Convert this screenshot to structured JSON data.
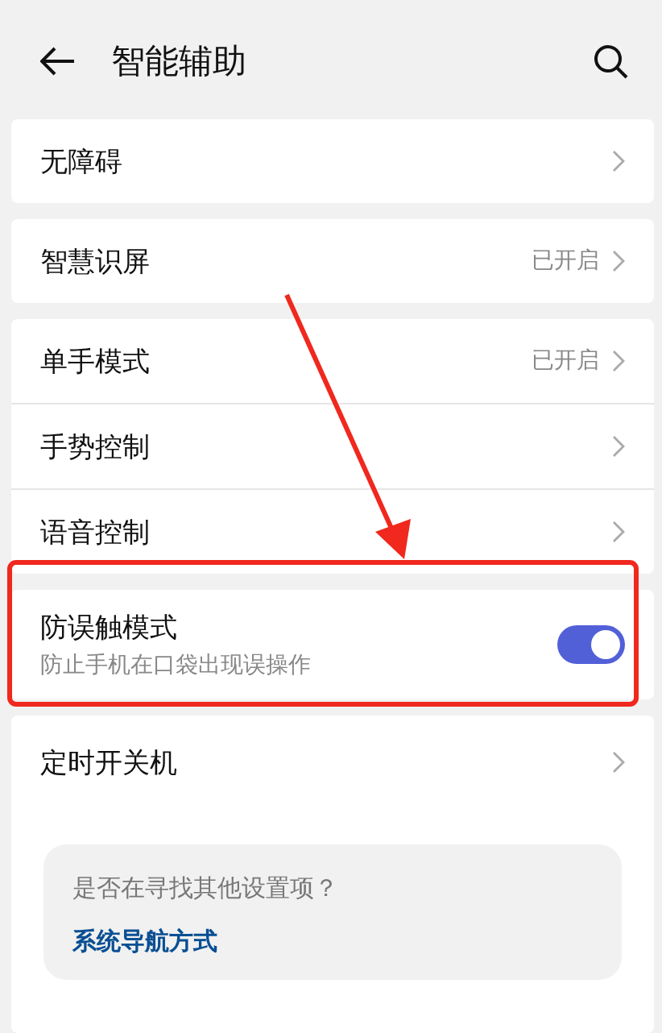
{
  "header": {
    "title": "智能辅助"
  },
  "groups": [
    {
      "items": [
        {
          "kind": "link",
          "label": "无障碍"
        }
      ]
    },
    {
      "items": [
        {
          "kind": "link",
          "label": "智慧识屏",
          "value": "已开启"
        }
      ]
    },
    {
      "items": [
        {
          "kind": "link",
          "label": "单手模式",
          "value": "已开启"
        },
        {
          "kind": "link",
          "label": "手势控制"
        },
        {
          "kind": "link",
          "label": "语音控制"
        }
      ]
    },
    {
      "items": [
        {
          "kind": "toggle",
          "label": "防误触模式",
          "subtitle": "防止手机在口袋出现误操作",
          "on": true
        }
      ]
    },
    {
      "items": [
        {
          "kind": "link",
          "label": "定时开关机"
        }
      ],
      "suggestion": {
        "question": "是否在寻找其他设置项？",
        "link": "系统导航方式"
      }
    }
  ]
}
